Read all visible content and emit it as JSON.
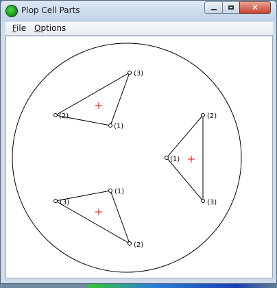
{
  "window": {
    "title": "Plop Cell Parts",
    "controls": {
      "minimize": "minimize",
      "maximize": "maximize",
      "close": "✕"
    }
  },
  "menu": {
    "file": {
      "label": "File",
      "mnemonic": "F",
      "rest": "ile"
    },
    "options": {
      "label": "Options",
      "mnemonic": "O",
      "rest": "ptions"
    }
  },
  "canvas": {
    "colors": {
      "outline": "#000000",
      "centroid": "#e00000",
      "background": "#ffffff"
    },
    "labels": {
      "t1_p3": "(3)",
      "t1_p2": "(2)",
      "t1_p1": "(1)",
      "t2_p2": "(2)",
      "t2_p1": "(1)",
      "t2_p3": "(3)",
      "t3_p1": "(1)",
      "t3_p3": "(3)",
      "t3_p2": "(2)"
    }
  }
}
